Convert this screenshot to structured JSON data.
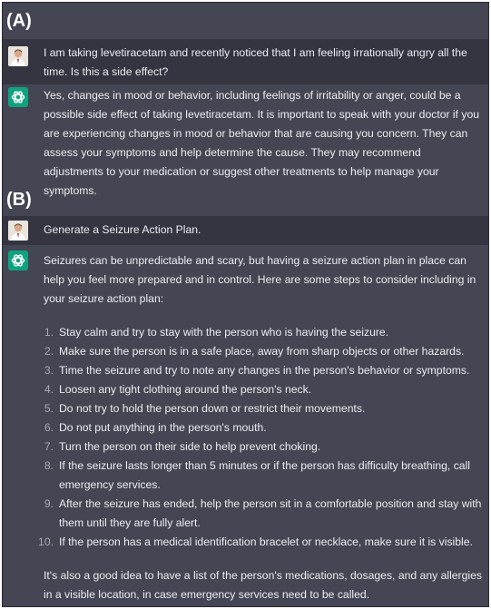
{
  "section_a": {
    "label": "(A)",
    "user_message": "I am taking levetiracetam and recently noticed that I am feeling irrationally angry all the time. Is this a side effect?",
    "assistant_message": "Yes, changes in mood or behavior, including feelings of irritability or anger, could be a possible side effect of taking levetiracetam. It is important to speak with your doctor if you are experiencing changes in mood or behavior that are causing you concern. They can assess your symptoms and help determine the cause. They may recommend adjustments to your medication or suggest other treatments to help manage your symptoms."
  },
  "section_b": {
    "label": "(B)",
    "user_message": "Generate a Seizure Action Plan.",
    "assistant_intro": "Seizures can be unpredictable and scary, but having a seizure action plan in place can help you feel more prepared and in control. Here are some steps to consider including in your seizure action plan:",
    "steps": [
      {
        "num": "1.",
        "text": "Stay calm and try to stay with the person who is having the seizure."
      },
      {
        "num": "2.",
        "text": "Make sure the person is in a safe place, away from sharp objects or other hazards."
      },
      {
        "num": "3.",
        "text": "Time the seizure and try to note any changes in the person's behavior or symptoms."
      },
      {
        "num": "4.",
        "text": "Loosen any tight clothing around the person's neck."
      },
      {
        "num": "5.",
        "text": "Do not try to hold the person down or restrict their movements."
      },
      {
        "num": "6.",
        "text": "Do not put anything in the person's mouth."
      },
      {
        "num": "7.",
        "text": "Turn the person on their side to help prevent choking."
      },
      {
        "num": "8.",
        "text": "If the seizure lasts longer than 5 minutes or if the person has difficulty breathing, call emergency services."
      },
      {
        "num": "9.",
        "text": "After the seizure has ended, help the person sit in a comfortable position and stay with them until they are fully alert."
      },
      {
        "num": "10.",
        "text": "If the person has a medical identification bracelet or necklace, make sure it is visible."
      }
    ],
    "assistant_outro": "It's also a good idea to have a list of the person's medications, dosages, and any allergies in a visible location, in case emergency services need to be called."
  },
  "icons": {
    "user_avatar": "user-avatar-icon",
    "assistant_logo": "openai-logo-icon"
  },
  "colors": {
    "user_band": "#343541",
    "assistant_band": "#444654",
    "assistant_logo_bg": "#10a37f",
    "text": "#ececf1"
  }
}
